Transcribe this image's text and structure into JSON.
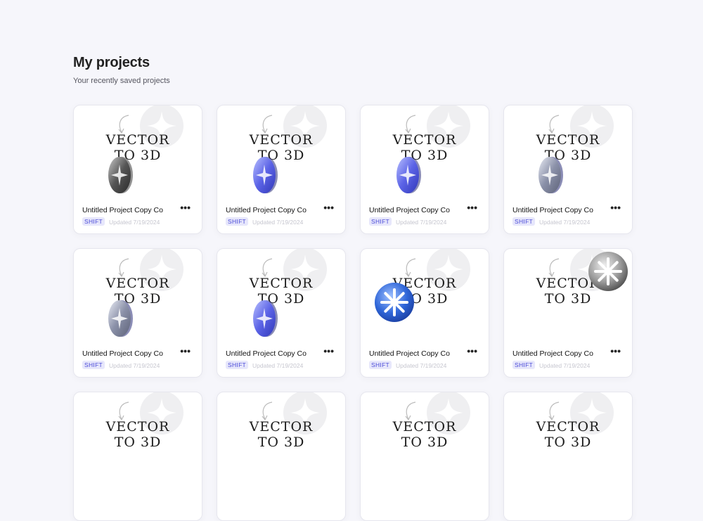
{
  "header": {
    "title": "My projects",
    "subtitle": "Your recently saved projects"
  },
  "thumbnail": {
    "line1": "VECTOR",
    "line2": "TO 3D"
  },
  "projects": [
    {
      "title": "Untitled Project Copy Co",
      "badge": "SHIFT",
      "updated": "Updated 7/19/2024",
      "style": "coin-gray"
    },
    {
      "title": "Untitled Project Copy Co",
      "badge": "SHIFT",
      "updated": "Updated 7/19/2024",
      "style": "coin-blue"
    },
    {
      "title": "Untitled Project Copy Co",
      "badge": "SHIFT",
      "updated": "Updated 7/19/2024",
      "style": "coin-blue"
    },
    {
      "title": "Untitled Project Copy Co",
      "badge": "SHIFT",
      "updated": "Updated 7/19/2024",
      "style": "coin-silver"
    },
    {
      "title": "Untitled Project Copy Co",
      "badge": "SHIFT",
      "updated": "Updated 7/19/2024",
      "style": "coin-silver"
    },
    {
      "title": "Untitled Project Copy Co",
      "badge": "SHIFT",
      "updated": "Updated 7/19/2024",
      "style": "coin-blue"
    },
    {
      "title": "Untitled Project Copy Co",
      "badge": "SHIFT",
      "updated": "Updated 7/19/2024",
      "style": "disc-blue"
    },
    {
      "title": "Untitled Project Copy Co",
      "badge": "SHIFT",
      "updated": "Updated 7/19/2024",
      "style": "disc-silver"
    },
    {
      "title": "",
      "badge": "",
      "updated": "",
      "style": "none"
    },
    {
      "title": "",
      "badge": "",
      "updated": "",
      "style": "none"
    },
    {
      "title": "",
      "badge": "",
      "updated": "",
      "style": "none"
    },
    {
      "title": "",
      "badge": "",
      "updated": "",
      "style": "none"
    }
  ],
  "colors": {
    "background": "#f6f6fb",
    "badge_text": "#4a4ad8",
    "badge_bg": "#e7e7fb"
  }
}
